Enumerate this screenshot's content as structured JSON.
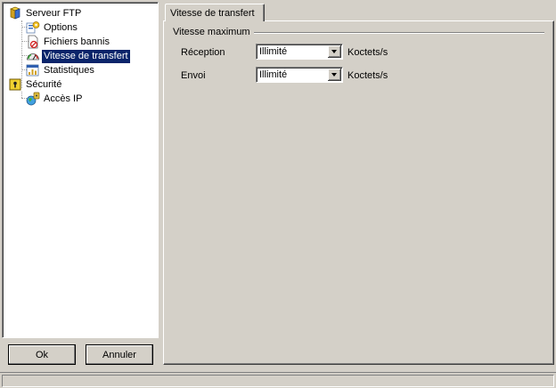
{
  "tree": {
    "ftp": {
      "label": "Serveur FTP",
      "icon": "server-icon",
      "children": [
        {
          "label": "Options",
          "icon": "options-icon"
        },
        {
          "label": "Fichiers bannis",
          "icon": "banned-files-icon"
        },
        {
          "label": "Vitesse de transfert",
          "icon": "speedometer-icon",
          "selected": true
        },
        {
          "label": "Statistiques",
          "icon": "statistics-icon"
        }
      ]
    },
    "security": {
      "label": "Sécurité",
      "icon": "lock-icon",
      "children": [
        {
          "label": "Accès IP",
          "icon": "ip-access-icon"
        }
      ]
    }
  },
  "buttons": {
    "ok": "Ok",
    "cancel": "Annuler"
  },
  "tab": {
    "label": "Vitesse de transfert"
  },
  "group": {
    "title": "Vitesse maximum",
    "fields": [
      {
        "label": "Réception",
        "value": "Illimité",
        "unit": "Koctets/s"
      },
      {
        "label": "Envoi",
        "value": "Illimité",
        "unit": "Koctets/s"
      }
    ]
  },
  "colors": {
    "selection": "#0a246a",
    "face": "#d4d0c8"
  }
}
